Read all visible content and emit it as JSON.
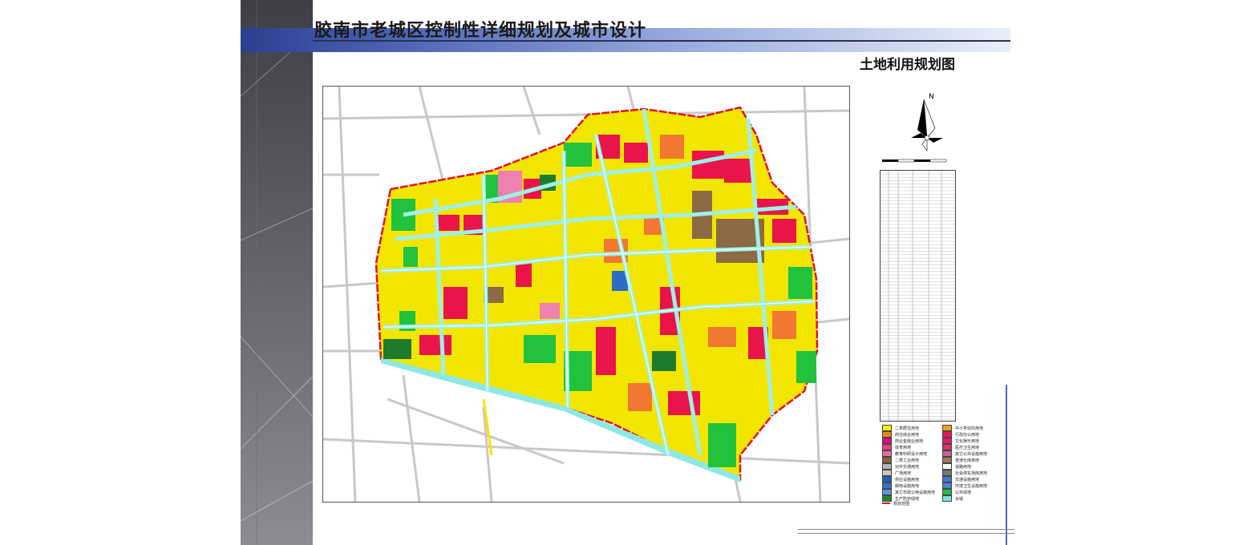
{
  "header": {
    "title": "胶南市老城区控制性详细规划及城市设计",
    "subtitle": "土地利用规划图"
  },
  "map": {
    "north_label": "N",
    "boundary_label": "规划范围"
  },
  "legend": {
    "items": [
      {
        "label": "二类居住用地",
        "color": "#f7f300"
      },
      {
        "label": "中小学幼托用地",
        "color": "#f0a020"
      },
      {
        "label": "商住综合用地",
        "color": "#e58a1c"
      },
      {
        "label": "行政办公用地",
        "color": "#e8145a"
      },
      {
        "label": "商业金融业用地",
        "color": "#e8008a"
      },
      {
        "label": "文化娱乐用地",
        "color": "#e8146e"
      },
      {
        "label": "体育用地",
        "color": "#ff3c78"
      },
      {
        "label": "医疗卫生用地",
        "color": "#e0325a"
      },
      {
        "label": "教育科研设计用地",
        "color": "#f06ca8"
      },
      {
        "label": "其它公共设施用地",
        "color": "#c86496"
      },
      {
        "label": "二类工业用地",
        "color": "#8c6440"
      },
      {
        "label": "普通仓库用地",
        "color": "#a07850"
      },
      {
        "label": "对外交通用地",
        "color": "#b4b4b4"
      },
      {
        "label": "道路用地",
        "color": "#ffffff"
      },
      {
        "label": "广场用地",
        "color": "#c8c8c8"
      },
      {
        "label": "社会停车场库用地",
        "color": "#787878"
      },
      {
        "label": "供应设施用地",
        "color": "#2060c0"
      },
      {
        "label": "交通设施用地",
        "color": "#3c78d0"
      },
      {
        "label": "邮电设施用地",
        "color": "#3a6ec8"
      },
      {
        "label": "环境卫生设施用地",
        "color": "#4a86d8"
      },
      {
        "label": "其它市政公用设施用地",
        "color": "#5a96e0"
      },
      {
        "label": "公共绿地",
        "color": "#20c040"
      },
      {
        "label": "生产防护绿地",
        "color": "#1a8a30"
      },
      {
        "label": "水域",
        "color": "#80e0e0"
      }
    ]
  },
  "colors": {
    "residential": "#f2e600",
    "commercial": "#e8144a",
    "green": "#22c23c",
    "industrial": "#8c6a44",
    "education": "#f07830",
    "water": "#8ee8e4",
    "road": "#ffffff",
    "boundary": "#e0102a",
    "pink": "#f080b0",
    "blue": "#2a6cc8",
    "darkgreen": "#1e7a2c"
  }
}
